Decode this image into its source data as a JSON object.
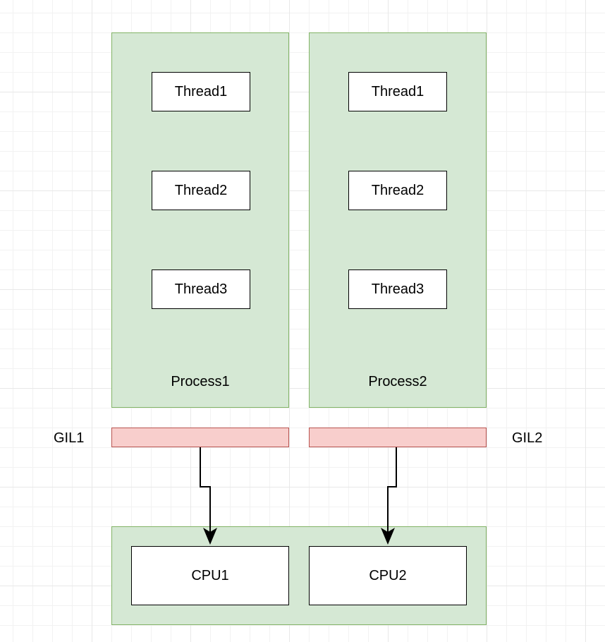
{
  "process1": {
    "label": "Process1",
    "threads": [
      "Thread1",
      "Thread2",
      "Thread3"
    ]
  },
  "process2": {
    "label": "Process2",
    "threads": [
      "Thread1",
      "Thread2",
      "Thread3"
    ]
  },
  "gil1": {
    "label": "GIL1"
  },
  "gil2": {
    "label": "GIL2"
  },
  "cpu1": {
    "label": "CPU1"
  },
  "cpu2": {
    "label": "CPU2"
  }
}
